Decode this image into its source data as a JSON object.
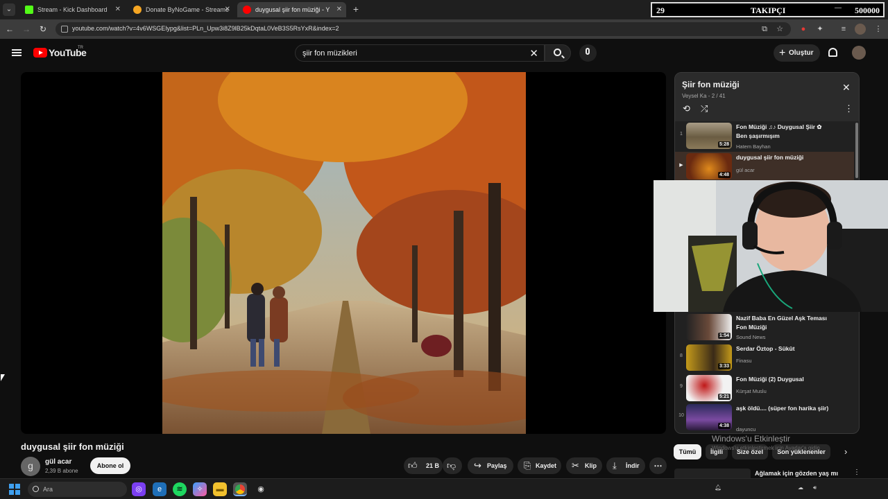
{
  "browser": {
    "tabs": [
      {
        "label": "Stream - Kick Dashboard",
        "active": false,
        "color": "#53fc18"
      },
      {
        "label": "Donate ByNoGame - Streamer",
        "active": false,
        "color": "#f5a623"
      },
      {
        "label": "duygusal şiir fon müziği - Y",
        "active": true,
        "color": "#ff0000"
      }
    ],
    "url": "youtube.com/watch?v=4v6WSGElypg&list=PLn_Upw3i8Z9lB25kDqtaL0VeB3S5RsYxR&index=2"
  },
  "counter": {
    "current": "29",
    "label": "TAKIPÇI",
    "goal": "500000"
  },
  "youtube": {
    "logo_text": "YouTube",
    "region": "TR",
    "search_query": "şiir fon müzikleri",
    "create_label": "Oluştur"
  },
  "video": {
    "title": "duygusal şiir fon müziği",
    "channel": "gül acar",
    "channel_initial": "g",
    "subscribers": "2,39 B abone",
    "subscribe_label": "Abone ol",
    "likes": "21 B",
    "share_label": "Paylaş",
    "save_label": "Kaydet",
    "clip_label": "Klip",
    "download_label": "İndir"
  },
  "playlist": {
    "title": "Şiir fon müziği",
    "meta": "Veysel Ka - 2 / 41",
    "items": [
      {
        "num": "1",
        "title": "Fon Müziği ♫♪ Duygusal Şiir ✿ Ben şaşırmışım",
        "author": "Hatem Bayhan",
        "duration": "5:28"
      },
      {
        "num": "▶",
        "title": "duygusal şiir fon müziği",
        "author": "gül acar",
        "duration": "4:48"
      },
      {
        "num": "",
        "title": "Nazif Baba En Güzel Aşk Teması Fon Müziği",
        "author": "Sound News",
        "duration": "1:54"
      },
      {
        "num": "8",
        "title": "Serdar Öztop - Sükût",
        "author": "Finasu",
        "duration": "3:33"
      },
      {
        "num": "9",
        "title": "Fon Müziği (2) Duygusal",
        "author": "Kürşat Muslu",
        "duration": "5:21"
      },
      {
        "num": "10",
        "title": "aşk öldü.... (süper fon harika şiir)",
        "author": "dayuncu",
        "duration": "4:38"
      }
    ]
  },
  "chips": [
    "Tümü",
    "İlgili",
    "Size özel",
    "Son yüklenenler"
  ],
  "watermark": {
    "title": "Windows'u Etkinleştir",
    "subtitle": "Windows'u etkinleştirmek için Ayarlar'a gidin"
  },
  "next_video": "Ağlamak için gözden yaş mı",
  "taskbar": {
    "search_placeholder": "Ara"
  }
}
